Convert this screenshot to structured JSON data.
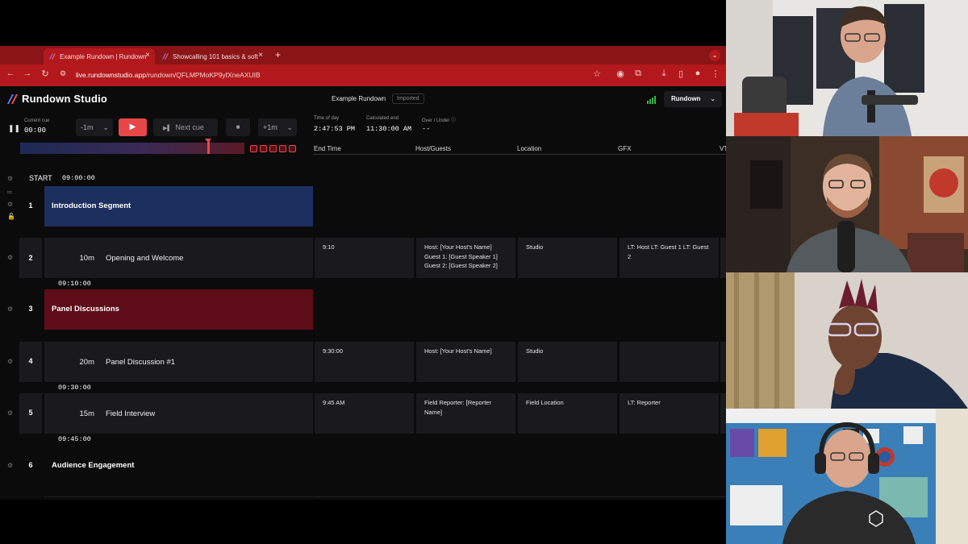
{
  "browser": {
    "tabs": [
      {
        "label": "Example Rundown | Rundown"
      },
      {
        "label": "Showcalling 101 basics & soft"
      }
    ],
    "new_tab": "+",
    "url_host": "live.rundownstudio.app",
    "url_path": "/rundown/QFLMPMoKP9yfXneAXUIB"
  },
  "app": {
    "name": "Rundown Studio",
    "rundown_name": "Example Rundown",
    "badge": "Imported",
    "view_selector": "Rundown"
  },
  "transport": {
    "current_cue_label": "Current cue",
    "current_cue_value": "00:00",
    "minus_label": "-1m",
    "next_cue_label": "Next cue",
    "plus_label": "+1m",
    "time_of_day_label": "Time of day",
    "time_of_day_value": "2:47:53 PM",
    "calculated_end_label": "Calculated end",
    "calculated_end_value": "11:30:00 AM",
    "over_under_label": "Over / Under",
    "over_under_value": "--",
    "timeline_progress": 0.83
  },
  "columns": [
    "End Time",
    "Host/Guests",
    "Location",
    "GFX",
    "VT"
  ],
  "start": {
    "label": "START",
    "time": "09:00:00"
  },
  "rows": [
    {
      "num": "1",
      "type": "segment",
      "title": "Introduction Segment",
      "color": "#1d2f5e"
    },
    {
      "num": "2",
      "type": "item",
      "duration": "10m",
      "title": "Opening and Welcome",
      "end_time": "9:10",
      "host_guests": "Host: [Your Host's Name] Guest 1: [Guest Speaker 1] Guest 2: [Guest Speaker 2]",
      "location": "Studio",
      "gfx": "LT: Host LT: Guest 1 LT: Guest 2",
      "after_time": "09:10:00"
    },
    {
      "num": "3",
      "type": "segment",
      "title": "Panel Discussions",
      "color": "#5e0d18"
    },
    {
      "num": "4",
      "type": "item",
      "duration": "20m",
      "title": "Panel Discussion #1",
      "end_time": "9:30:00",
      "host_guests": "Host: [Your Host's Name]",
      "location": "Studio",
      "gfx": "",
      "after_time": "09:30:00"
    },
    {
      "num": "5",
      "type": "item",
      "duration": "15m",
      "title": "Field Interview",
      "end_time": "9:45 AM",
      "host_guests": "Field Reporter: [Reporter Name]",
      "location": "Field Location",
      "gfx": "LT: Reporter",
      "after_time": "09:45:00"
    },
    {
      "num": "6",
      "type": "segment",
      "title": "Audience Engagement",
      "color": "#0b0b0c"
    }
  ],
  "icons": {
    "back": "arrow-left-icon",
    "forward": "arrow-right-icon",
    "reload": "reload-icon",
    "star": "star-icon",
    "pause": "pause-icon",
    "play": "play-icon",
    "next": "skip-icon",
    "stop": "stop-icon",
    "gear": "gear-icon"
  },
  "colors": {
    "accent": "#e8474a",
    "browser_chrome": "#b3191c",
    "segment_blue": "#1d2f5e",
    "segment_red": "#5e0d18"
  },
  "video_tiles": [
    {
      "participant": 1
    },
    {
      "participant": 2
    },
    {
      "participant": 3
    },
    {
      "participant": 4
    }
  ]
}
